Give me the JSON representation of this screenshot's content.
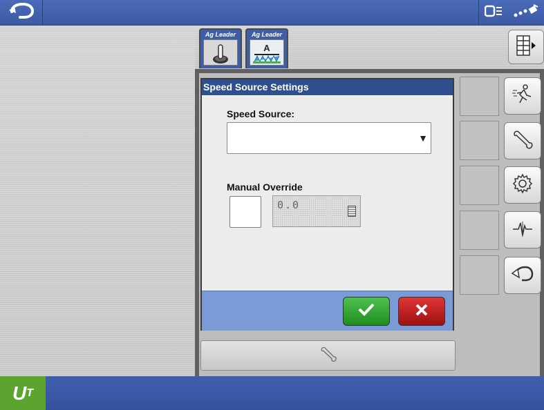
{
  "topbar": {
    "back_icon": "u-turn-back-icon",
    "status_icons": [
      "display-icon",
      "gps-signal-icon"
    ]
  },
  "tabs": [
    {
      "label": "Ag Leader",
      "icon": "joystick-icon"
    },
    {
      "label": "Ag Leader",
      "icon": "sprayer-icon",
      "badge": "A"
    }
  ],
  "dialog": {
    "title": "Speed Source Settings",
    "speed_source_label": "Speed Source:",
    "speed_source_value": "",
    "manual_override_label": "Manual Override",
    "manual_override_value": "0.0",
    "manual_override_checked": false
  },
  "side_buttons": [
    "running-person-icon",
    "wrench-icon",
    "gear-icon",
    "pulse-icon",
    "u-turn-icon"
  ],
  "bottom": {
    "logo_text": "U",
    "logo_sub": "T"
  },
  "colors": {
    "bar_blue": "#3c5aa6",
    "ok_green": "#2aa52a",
    "cancel_red": "#c01c1c",
    "footer_blue": "#7b9bd6"
  }
}
